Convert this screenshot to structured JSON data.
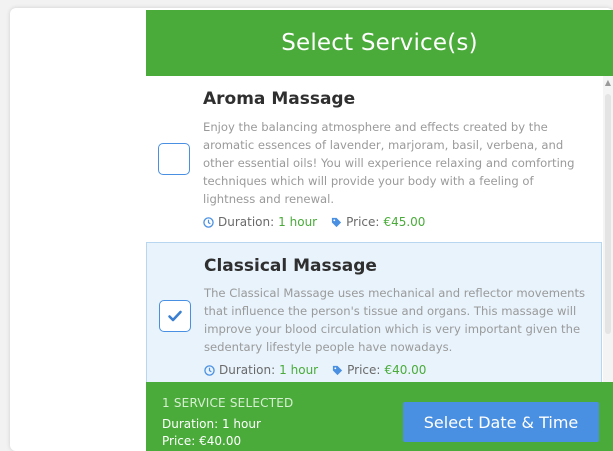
{
  "modal": {
    "title": "Select Service(s)"
  },
  "services": [
    {
      "name": "Aroma Massage",
      "description": "Enjoy the balancing atmosphere and effects created by the aromatic essences of lavender, marjoram, basil, verbena, and other essential oils! You will experience relaxing and comforting techniques which will provide your body with a feeling of lightness and renewal.",
      "duration_label": "Duration:",
      "duration_value": "1 hour",
      "price_label": "Price:",
      "price_value": "€45.00",
      "selected": false
    },
    {
      "name": "Classical Massage",
      "description": "The Classical Massage uses mechanical and reflector movements that influence the person's tissue and organs. This massage will improve your blood circulation which is very important given the sedentary lifestyle people have nowadays.",
      "duration_label": "Duration:",
      "duration_value": "1 hour",
      "price_label": "Price:",
      "price_value": "€40.00",
      "selected": true
    }
  ],
  "footer": {
    "selected_count": "1 SERVICE SELECTED",
    "duration": "Duration: 1 hour",
    "price": "Price: €40.00",
    "button_label": "Select Date & Time"
  },
  "colors": {
    "header_green": "#4aab3a",
    "accent_blue": "#4a90e2",
    "selected_bg": "#e8f3fc",
    "value_green": "#4aab3a"
  },
  "icons": [
    "clock-icon",
    "tag-icon",
    "checkmark-icon",
    "scroll-up-arrow-icon"
  ]
}
